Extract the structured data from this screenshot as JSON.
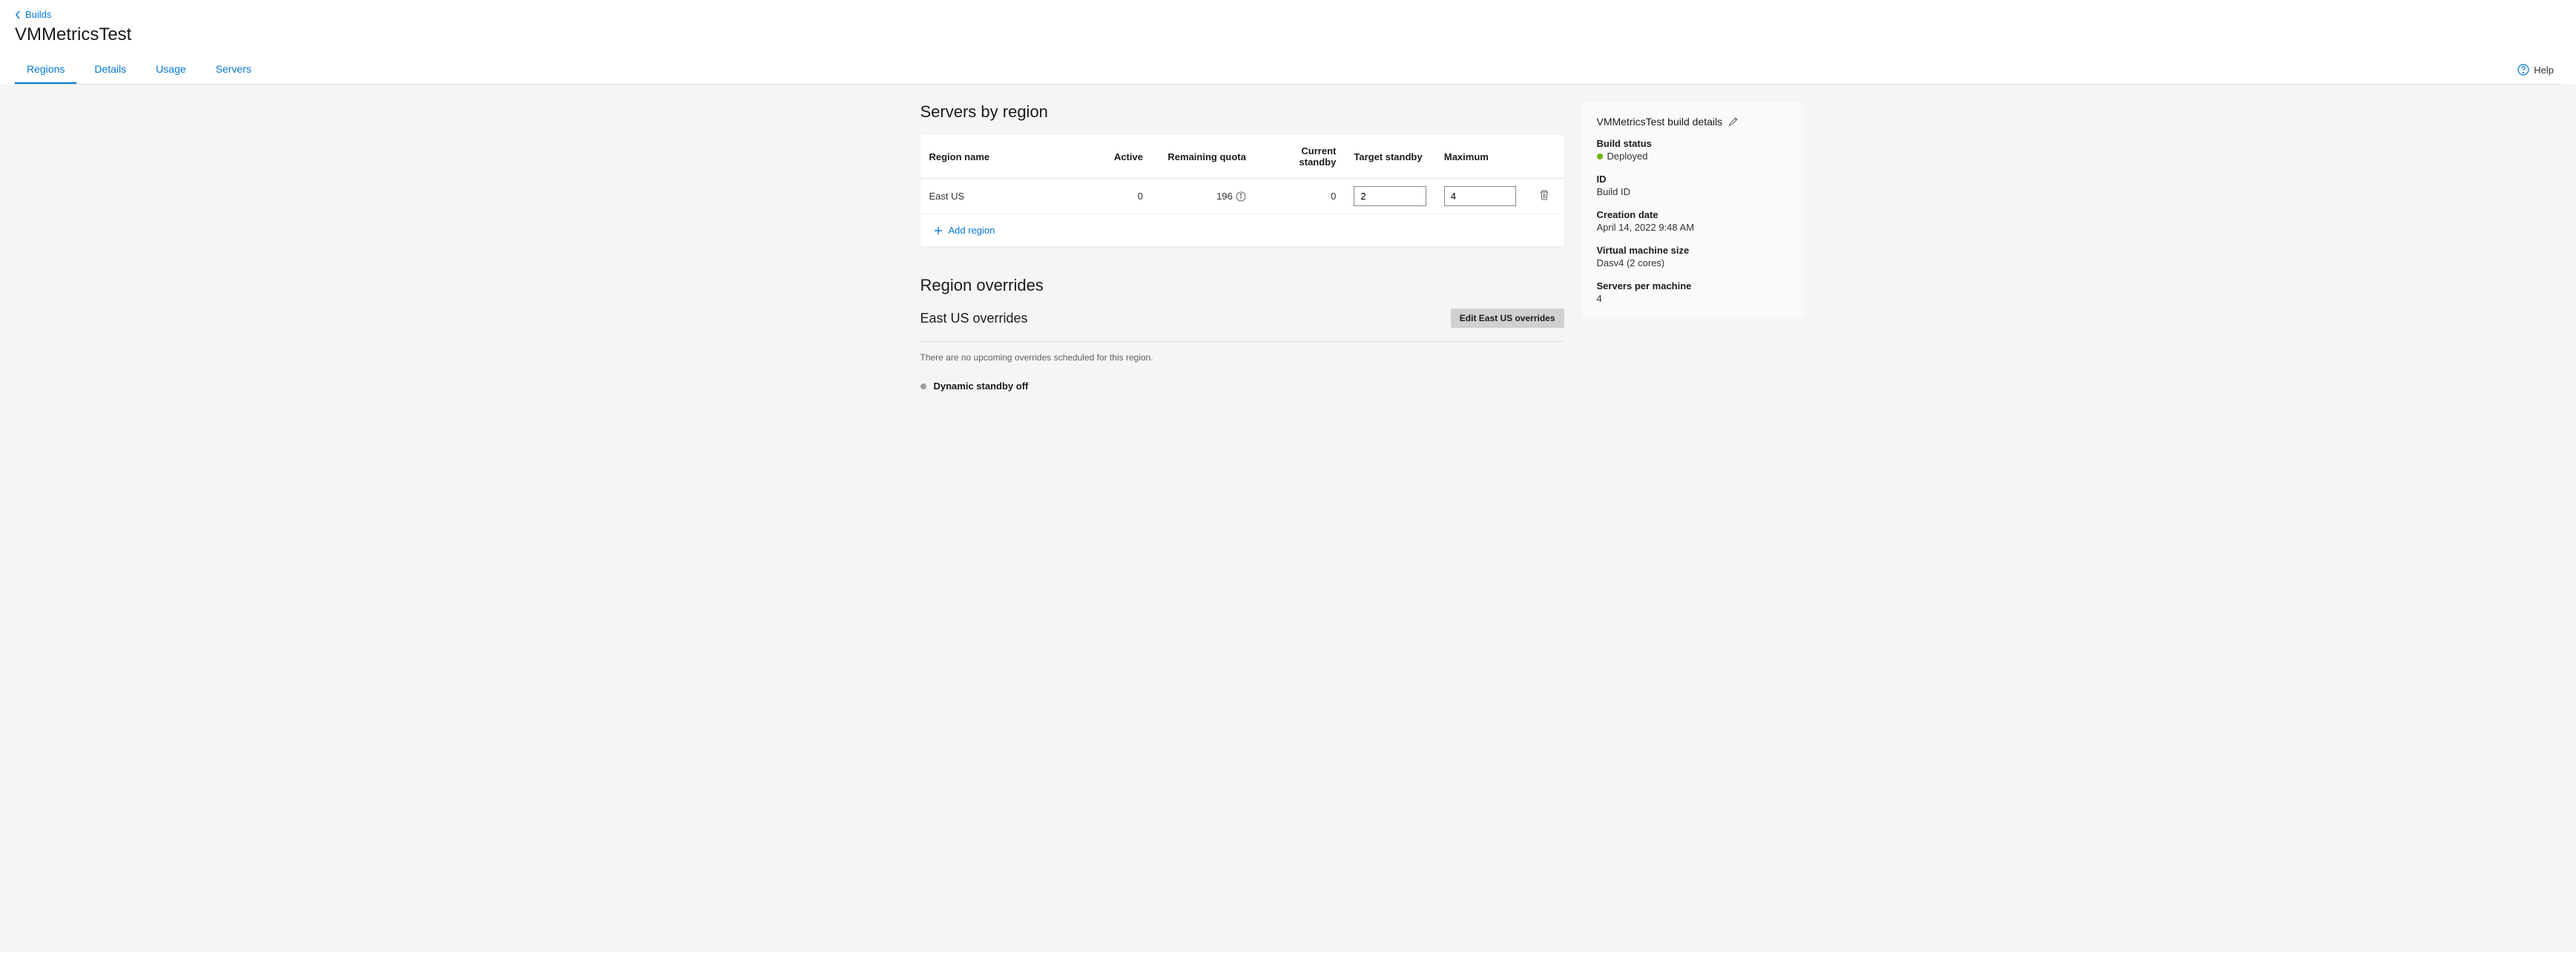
{
  "breadcrumb": {
    "label": "Builds"
  },
  "page_title": "VMMetricsTest",
  "tabs": [
    {
      "label": "Regions",
      "active": true
    },
    {
      "label": "Details",
      "active": false
    },
    {
      "label": "Usage",
      "active": false
    },
    {
      "label": "Servers",
      "active": false
    }
  ],
  "help": {
    "label": "Help"
  },
  "servers_by_region": {
    "title": "Servers by region",
    "columns": {
      "region_name": "Region name",
      "active": "Active",
      "remaining_quota": "Remaining quota",
      "current_standby": "Current standby",
      "target_standby": "Target standby",
      "maximum": "Maximum"
    },
    "rows": [
      {
        "region_name": "East US",
        "active": "0",
        "remaining_quota": "196",
        "current_standby": "0",
        "target_standby": "2",
        "maximum": "4"
      }
    ],
    "add_region_label": "Add region"
  },
  "region_overrides": {
    "title": "Region overrides",
    "subtitle": "East US overrides",
    "edit_button": "Edit East US overrides",
    "empty_text": "There are no upcoming overrides scheduled for this region.",
    "dynamic_standby": "Dynamic standby off"
  },
  "build_details": {
    "title": "VMMetricsTest build details",
    "status_label": "Build status",
    "status_value": "Deployed",
    "id_label": "ID",
    "id_value": "Build ID",
    "creation_label": "Creation date",
    "creation_value": "April 14, 2022 9:48 AM",
    "vm_size_label": "Virtual machine size",
    "vm_size_value": "Dasv4 (2 cores)",
    "servers_per_label": "Servers per machine",
    "servers_per_value": "4"
  }
}
